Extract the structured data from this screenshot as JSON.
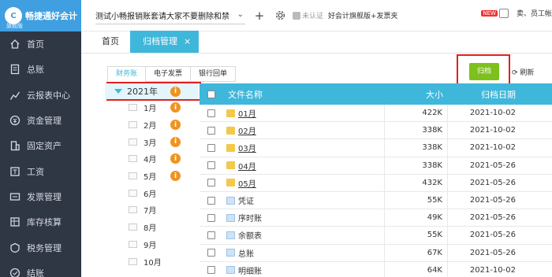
{
  "app": {
    "logo_text": "畅捷通好会计",
    "logo_sub": "旗舰版",
    "logo_mark": "C"
  },
  "sidebar": {
    "items": [
      {
        "label": "首页",
        "icon": "home-icon"
      },
      {
        "label": "总账",
        "icon": "ledger-icon"
      },
      {
        "label": "云报表中心",
        "icon": "chart-icon"
      },
      {
        "label": "资金管理",
        "icon": "money-icon"
      },
      {
        "label": "固定资产",
        "icon": "building-icon"
      },
      {
        "label": "工资",
        "icon": "wage-icon"
      },
      {
        "label": "发票管理",
        "icon": "invoice-icon"
      },
      {
        "label": "库存核算",
        "icon": "stock-icon"
      },
      {
        "label": "税务管理",
        "icon": "tax-icon"
      },
      {
        "label": "结账",
        "icon": "close-account-icon"
      }
    ]
  },
  "topbar": {
    "company": "测试小畅报销账套请大家不要删除和禁用",
    "cert": "未认证",
    "edition": "好会计旗舰版+发票夹",
    "new_badge": "NEW",
    "right_text": "卖、员工帐"
  },
  "tabs": {
    "home": "首页",
    "active": "归档管理",
    "close": "×"
  },
  "subtabs": [
    "财务账",
    "电子发票",
    "银行回单"
  ],
  "actions": {
    "archive": "归档",
    "refresh": "刷新"
  },
  "tree": {
    "year": "2021年",
    "months": [
      {
        "label": "1月",
        "info": true
      },
      {
        "label": "2月",
        "info": true
      },
      {
        "label": "3月",
        "info": true
      },
      {
        "label": "4月",
        "info": true
      },
      {
        "label": "5月",
        "info": true
      },
      {
        "label": "6月",
        "info": false
      },
      {
        "label": "7月",
        "info": false
      },
      {
        "label": "8月",
        "info": false
      },
      {
        "label": "9月",
        "info": false
      },
      {
        "label": "10月",
        "info": false
      }
    ]
  },
  "table": {
    "headers": {
      "name": "文件名称",
      "size": "大小",
      "date": "归档日期"
    },
    "rows": [
      {
        "name": "01月",
        "type": "folder",
        "size": "422K",
        "date": "2021-10-02"
      },
      {
        "name": "02月",
        "type": "folder",
        "size": "338K",
        "date": "2021-10-02"
      },
      {
        "name": "03月",
        "type": "folder",
        "size": "338K",
        "date": "2021-10-02"
      },
      {
        "name": "04月",
        "type": "folder",
        "size": "338K",
        "date": "2021-05-26"
      },
      {
        "name": "05月",
        "type": "folder",
        "size": "432K",
        "date": "2021-05-26"
      },
      {
        "name": "凭证",
        "type": "doc",
        "size": "55K",
        "date": "2021-05-26"
      },
      {
        "name": "序时账",
        "type": "doc",
        "size": "49K",
        "date": "2021-05-26"
      },
      {
        "name": "余额表",
        "type": "doc",
        "size": "55K",
        "date": "2021-05-26"
      },
      {
        "name": "总账",
        "type": "doc",
        "size": "67K",
        "date": "2021-05-26"
      },
      {
        "name": "明细账",
        "type": "doc",
        "size": "64K",
        "date": "2021-10-02"
      }
    ]
  },
  "colors": {
    "sidebar_bg": "#2f3644",
    "accent": "#3fb7da",
    "archive_btn": "#7ec01e",
    "highlight_box": "#e02020",
    "info_badge": "#f0931f"
  }
}
